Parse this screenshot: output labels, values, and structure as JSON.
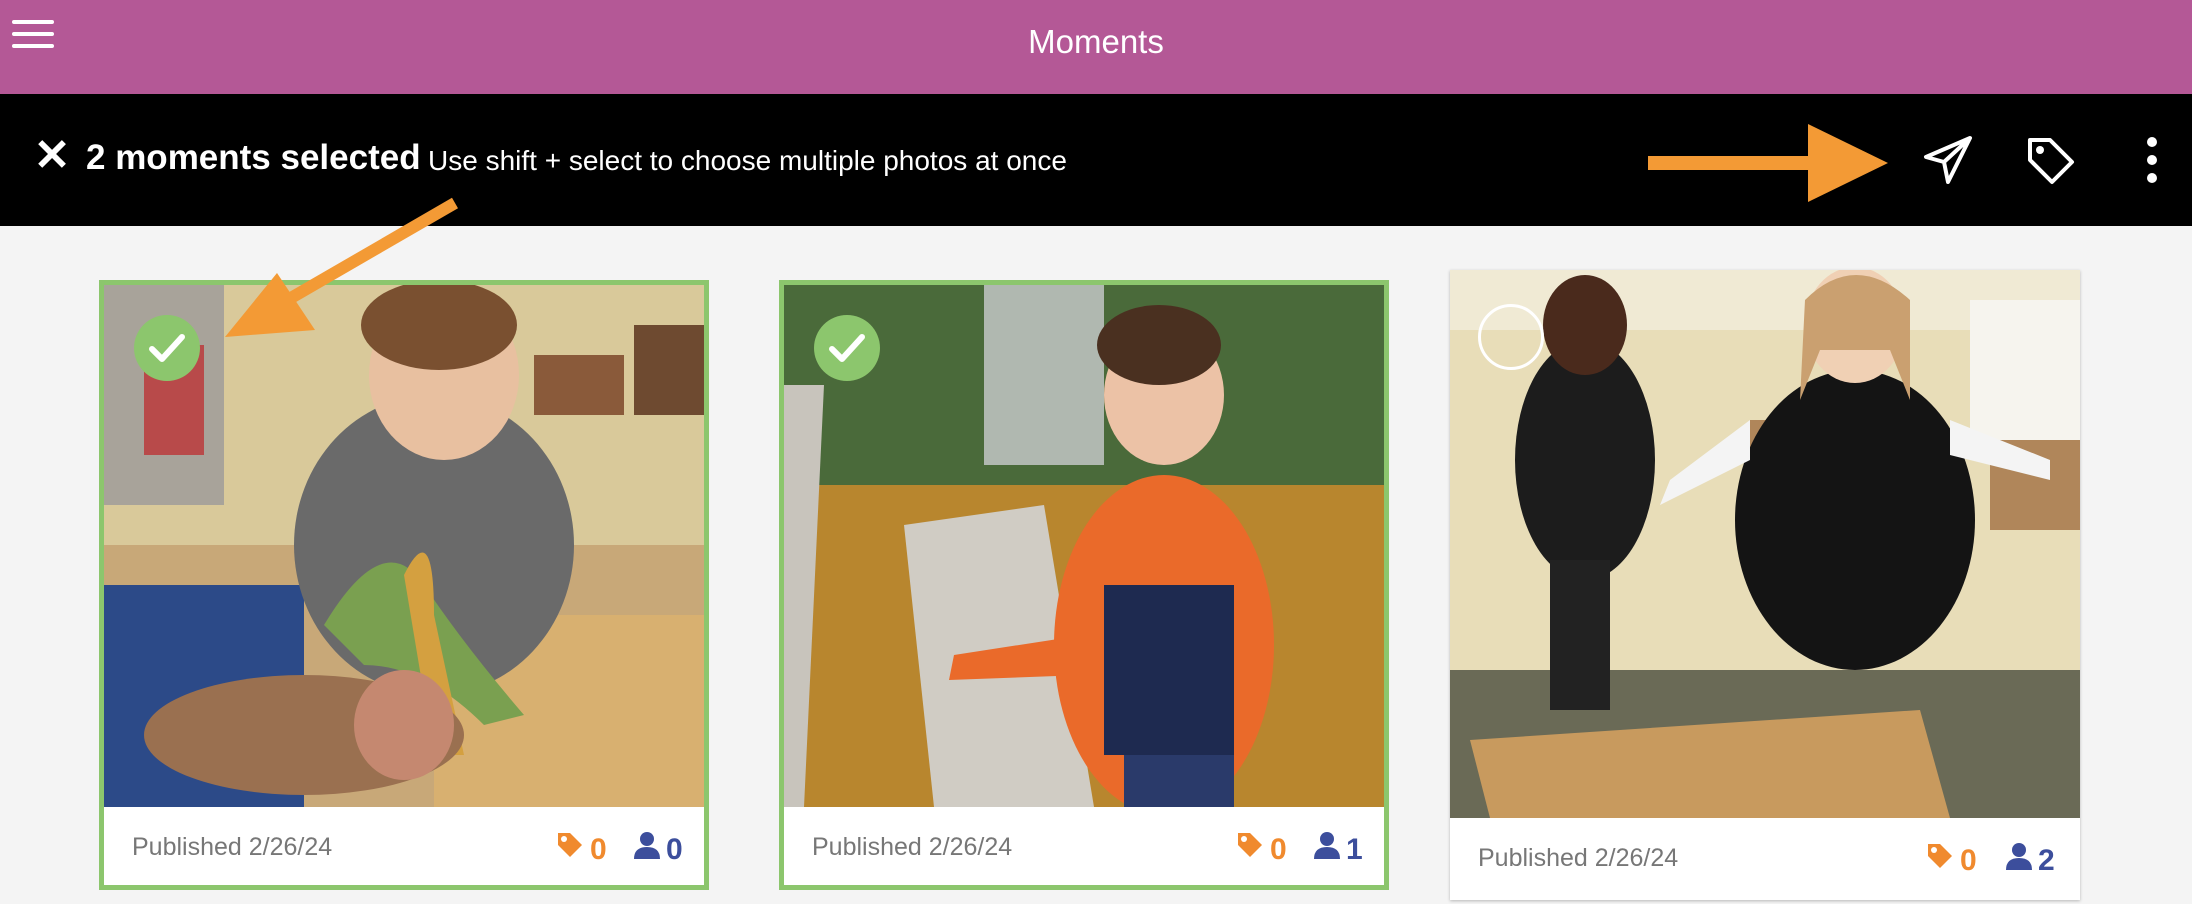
{
  "header": {
    "title": "Moments",
    "menu_icon": "hamburger-menu-icon",
    "color": "#b45896"
  },
  "selection_bar": {
    "count_label": "2 moments selected",
    "hint": "Use shift + select to choose multiple photos at once",
    "actions": [
      "send-icon",
      "tag-icon",
      "more-vertical-icon"
    ]
  },
  "moments": [
    {
      "published": "Published 2/26/24",
      "tags": "0",
      "people": "0",
      "selected": true,
      "photo_alt": "Child playing with toy dinosaurs"
    },
    {
      "published": "Published 2/26/24",
      "tags": "0",
      "people": "1",
      "selected": true,
      "photo_alt": "Toddler touching leaves on a bench"
    },
    {
      "published": "Published 2/26/24",
      "tags": "0",
      "people": "2",
      "selected": false,
      "photo_alt": "Two children holding hands balancing on boards"
    }
  ],
  "colors": {
    "selected_outline": "#8cc66d",
    "tag": "#f08a2e",
    "people": "#3c4e9c",
    "annotation_arrow": "#f39a35"
  }
}
